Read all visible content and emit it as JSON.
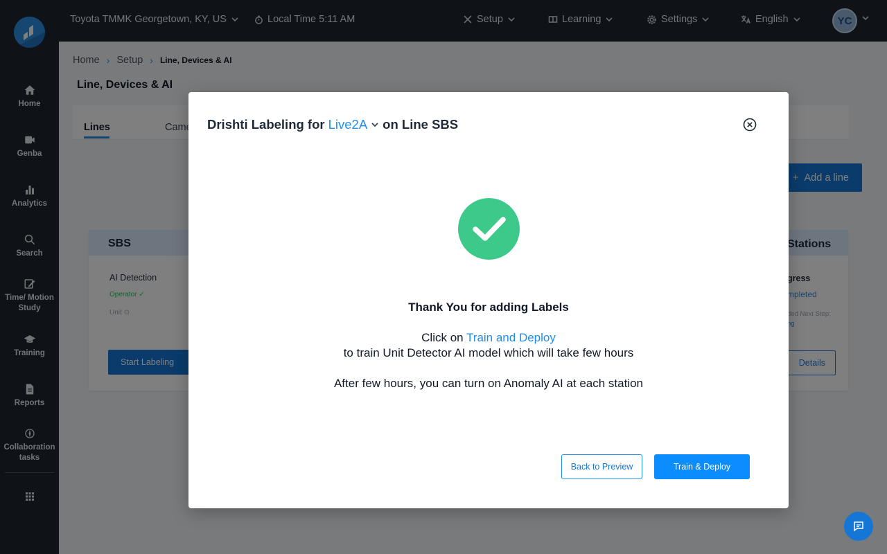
{
  "sidebar": {
    "items": [
      {
        "label": "Home",
        "icon": "home-icon"
      },
      {
        "label": "Genba",
        "icon": "camera-icon"
      },
      {
        "label": "Analytics",
        "icon": "bar-chart-icon"
      },
      {
        "label": "Search",
        "icon": "search-icon"
      },
      {
        "label": "Time/ Motion Study",
        "icon": "edit-icon"
      },
      {
        "label": "Training",
        "icon": "graduation-cap-icon"
      },
      {
        "label": "Reports",
        "icon": "document-icon"
      },
      {
        "label": "Collaboration tasks",
        "icon": "compass-icon"
      }
    ],
    "apps_icon": "grid-icon"
  },
  "topbar": {
    "location": "Toyota TMMK Georgetown, KY, US",
    "local_time": "Local Time 5:11 AM",
    "setup": "Setup",
    "learning": "Learning",
    "settings": "Settings",
    "language": "English",
    "avatar_initials": "YC"
  },
  "breadcrumb": {
    "home": "Home",
    "setup": "Setup",
    "current": "Line, Devices & AI"
  },
  "page": {
    "title": "Line, Devices & AI",
    "tabs": [
      {
        "label": "Lines"
      },
      {
        "label": "Came"
      }
    ],
    "add_line": "Add a line"
  },
  "line_card": {
    "name": "SBS",
    "ai_detection": "AI Detection",
    "operator": "Operator",
    "unit": "Unit",
    "start_labeling": "Start Labeling",
    "stations": "Stations",
    "progress": "gress",
    "completed": "mpleted",
    "next_step": "ded Next Step:",
    "next_step_value": "ng",
    "details": "Details"
  },
  "modal": {
    "title_prefix": "Drishti Labeling for",
    "model_name": "Live2A",
    "title_suffix": "on Line SBS",
    "message_title": "Thank You for adding Labels",
    "click_on": "Click on",
    "train_link": "Train and Deploy",
    "train_desc": "to train Unit Detector AI model which will take few hours",
    "after_text": "After few hours, you can turn on Anomaly AI at each station",
    "back_button": "Back to Preview",
    "train_button": "Train & Deploy"
  },
  "colors": {
    "sidebar_bg": "#1f2630",
    "accent": "#0b8cff",
    "success": "#3cc98a"
  }
}
